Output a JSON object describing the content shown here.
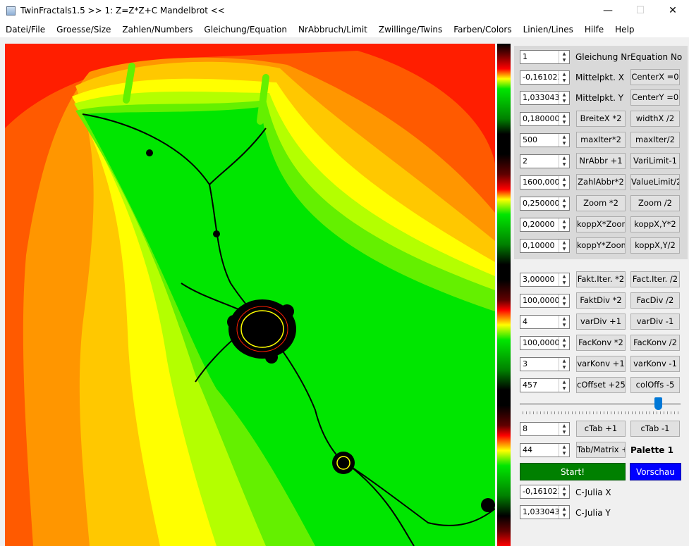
{
  "window": {
    "title": "TwinFractals1.5 >> 1: Z=Z*Z+C Mandelbrot <<",
    "minimize": "—",
    "maximize": "☐",
    "close": "✕"
  },
  "menu": [
    "Datei/File",
    "Groesse/Size",
    "Zahlen/Numbers",
    "Gleichung/Equation",
    "NrAbbruch/Limit",
    "Zwillinge/Twins",
    "Farben/Colors",
    "Linien/Lines",
    "Hilfe",
    "Help"
  ],
  "rows": [
    {
      "value": "1",
      "label": "Gleichung Nr",
      "right": "Equation No"
    },
    {
      "value": "-0,161023",
      "label": "Mittelpkt. X",
      "right": "CenterX =0"
    },
    {
      "value": "1,0330432",
      "label": "Mittelpkt. Y",
      "right": "CenterY =0"
    },
    {
      "value": "0,1800000",
      "button1": "BreiteX *2",
      "button2": "widthX /2"
    },
    {
      "value": "500",
      "button1": "maxIter*2",
      "button2": "maxIter/2"
    },
    {
      "value": "2",
      "button1": "NrAbbr +1",
      "button2": "VariLimit-1"
    },
    {
      "value": "1600,0000",
      "button1": "ZahlAbbr*2",
      "button2": "ValueLimit/2"
    },
    {
      "value": "0,2500000",
      "button1": "Zoom *2",
      "button2": "Zoom /2"
    },
    {
      "value": "0,20000",
      "button1": "koppX*Zoom",
      "button2": "koppX,Y*2"
    },
    {
      "value": "0,10000",
      "button1": "koppY*Zoom",
      "button2": "koppX,Y/2"
    },
    {
      "value": "3,00000",
      "button1": "Fakt.Iter. *2",
      "button2": "Fact.Iter. /2"
    },
    {
      "value": "100,00000",
      "button1": "FaktDiv *2",
      "button2": "FacDiv /2"
    },
    {
      "value": "4",
      "button1": "varDiv +1",
      "button2": "varDiv -1"
    },
    {
      "value": "100,00000",
      "button1": "FacKonv *2",
      "button2": "FacKonv /2"
    },
    {
      "value": "3",
      "button1": "varKonv +1",
      "button2": "varKonv -1"
    },
    {
      "value": "457",
      "button1": "cOffset +25",
      "button2": "colOffs -5"
    },
    {
      "value": "8",
      "button1": "cTab +1",
      "button2": "cTab -1"
    },
    {
      "value": "44",
      "button1": "Tab/Matrix +",
      "label": "Palette 1"
    }
  ],
  "start_label": "Start!",
  "preview_label": "Vorschau",
  "julia": [
    {
      "value": "-0,161023",
      "label": "C-Julia X"
    },
    {
      "value": "1,0330432",
      "label": "C-Julia Y"
    }
  ],
  "slider_value": 0.86,
  "colors": {
    "red": "#ff1e00",
    "orange_red": "#ff5a00",
    "orange": "#ff9600",
    "amber": "#ffc800",
    "yellow": "#ffff00",
    "yellow_green": "#b4ff00",
    "green_light": "#64f000",
    "green": "#00e600",
    "black": "#000000"
  }
}
